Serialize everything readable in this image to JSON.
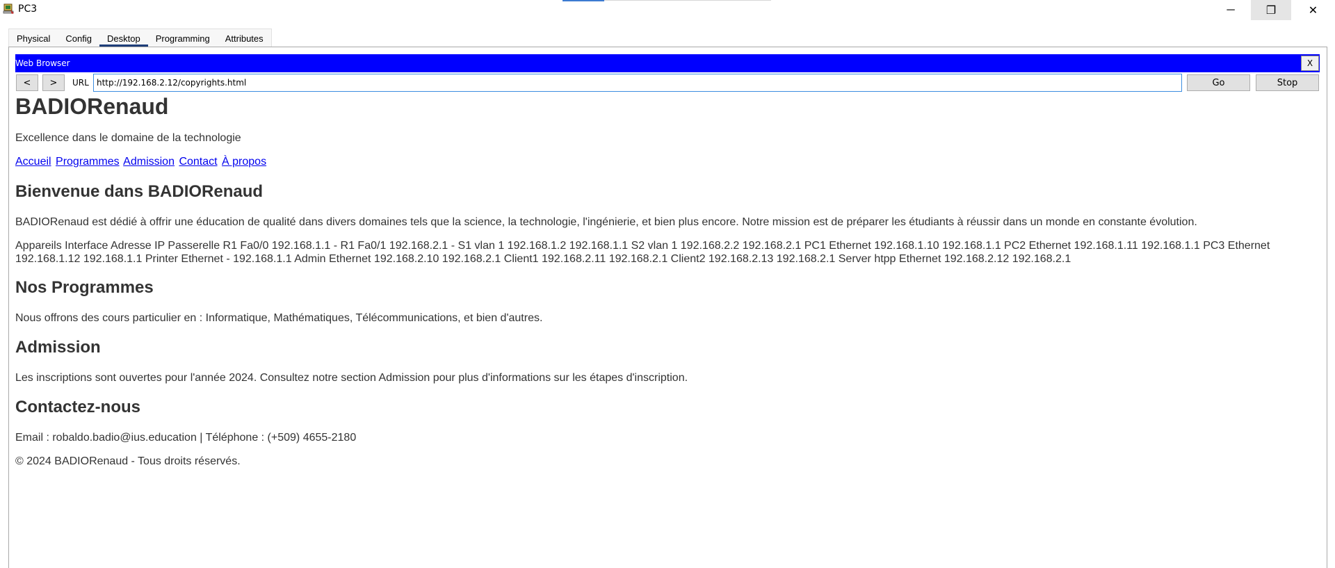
{
  "window": {
    "title": "PC3",
    "minimize_symbol": "─",
    "restore_symbol": "❐",
    "close_symbol": "✕",
    "icon": "packet-tracer-pc-icon"
  },
  "tabs": [
    {
      "label": "Physical",
      "active": false
    },
    {
      "label": "Config",
      "active": false
    },
    {
      "label": "Desktop",
      "active": true
    },
    {
      "label": "Programming",
      "active": false
    },
    {
      "label": "Attributes",
      "active": false
    }
  ],
  "browser": {
    "title": "Web Browser",
    "close_label": "X",
    "back_label": "<",
    "forward_label": ">",
    "url_label": "URL",
    "url_value": "http://192.168.2.12/copyrights.html",
    "go_label": "Go",
    "stop_label": "Stop"
  },
  "page": {
    "site_title": "BADIORenaud",
    "tagline": "Excellence dans le domaine de la technologie",
    "nav": [
      "Accueil",
      "Programmes",
      "Admission",
      "Contact",
      "À propos"
    ],
    "welcome_heading": "Bienvenue dans BADIORenaud",
    "welcome_text": "BADIORenaud est dédié à offrir une éducation de qualité dans divers domaines tels que la science, la technologie, l'ingénierie, et bien plus encore. Notre mission est de préparer les étudiants à réussir dans un monde en constante évolution.",
    "table_text": "Appareils Interface Adresse IP Passerelle R1 Fa0/0 192.168.1.1 - R1 Fa0/1 192.168.2.1 - S1 vlan 1 192.168.1.2 192.168.1.1 S2 vlan 1 192.168.2.2 192.168.2.1 PC1 Ethernet 192.168.1.10 192.168.1.1 PC2 Ethernet 192.168.1.11 192.168.1.1 PC3 Ethernet 192.168.1.12 192.168.1.1 Printer Ethernet - 192.168.1.1 Admin Ethernet 192.168.2.10 192.168.2.1 Client1 192.168.2.11 192.168.2.1 Client2 192.168.2.13 192.168.2.1 Server htpp Ethernet 192.168.2.12 192.168.2.1",
    "programs_heading": "Nos Programmes",
    "programs_text": "Nous offrons des cours particulier en : Informatique, Mathématiques, Télécommunications, et bien d'autres.",
    "admission_heading": "Admission",
    "admission_text": "Les inscriptions sont ouvertes pour l'année 2024. Consultez notre section Admission pour plus d'informations sur les étapes d'inscription.",
    "contact_heading": "Contactez-nous",
    "contact_text": "Email : robaldo.badio@ius.education | Téléphone : (+509) 4655-2180",
    "footer_text": "© 2024 BADIORenaud - Tous droits réservés."
  },
  "colors": {
    "browser_titlebar": "#0000ff",
    "link": "#0000ee",
    "text": "#333333",
    "active_tab_underline": "#1f3f7a"
  }
}
